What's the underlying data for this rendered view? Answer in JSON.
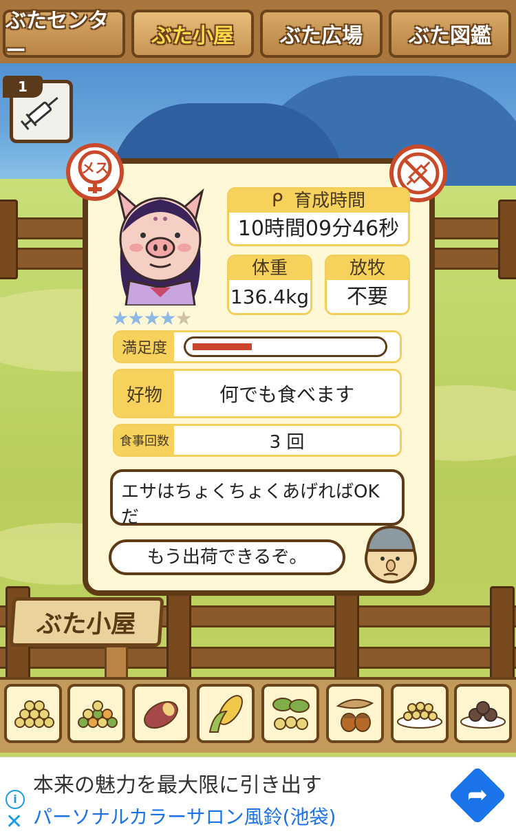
{
  "tabs": [
    {
      "label": "ぶたセンター",
      "active": false
    },
    {
      "label": "ぶた小屋",
      "active": true
    },
    {
      "label": "ぶた広場",
      "active": false
    },
    {
      "label": "ぶた図鑑",
      "active": false
    }
  ],
  "item": {
    "count": "1",
    "icon": "syringe-icon"
  },
  "card": {
    "gender_badge": "メス",
    "no_injection_icon": "no-syringe-icon",
    "stars": {
      "rating": 4,
      "max": 5
    },
    "growth_time": {
      "header": "育成時間",
      "value": "10時間09分46秒"
    },
    "weight": {
      "header": "体重",
      "value": "136.4kg"
    },
    "grazing": {
      "header": "放牧",
      "value": "不要"
    },
    "satisfaction": {
      "label": "満足度",
      "level": 0.32,
      "color": "#c9452c"
    },
    "favorite": {
      "label": "好物",
      "value": "何でも食べます"
    },
    "meals": {
      "label": "食事回数",
      "value": "3 回"
    },
    "speech1": "エサはちょくちょくあげればOKだ",
    "speech2": "もう出荷できるぞ。"
  },
  "sign": {
    "label": "ぶた小屋"
  },
  "foods": [
    "grain-pile-icon",
    "mixed-beans-icon",
    "sweet-potato-icon",
    "corn-icon",
    "leaf-nuts-icon",
    "acorn-icon",
    "soybean-bowl-icon",
    "dumpling-plate-icon"
  ],
  "ad": {
    "title": "本来の魅力を最大限に引き出す",
    "subtitle": "パーソナルカラーサロン風鈴(池袋)",
    "accent": "#1a73e8"
  },
  "colors": {
    "wood": "#6b431b",
    "card_bg": "#fff8d6",
    "label_bg": "#f6d15b",
    "badge_red": "#c94a2a"
  }
}
